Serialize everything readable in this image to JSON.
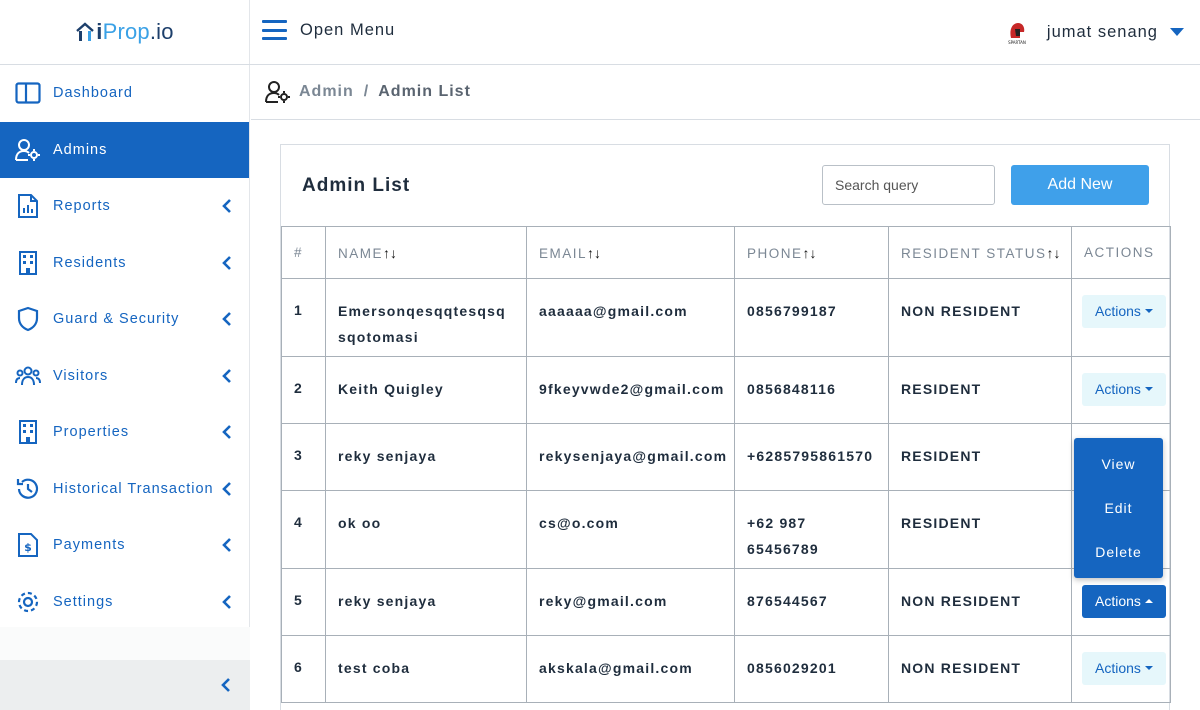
{
  "brand": {
    "name_part1": "i",
    "name_part2": "Prop",
    "name_part3": ".io"
  },
  "header": {
    "menu_label": "Open Menu",
    "user_name": "jumat senang",
    "avatar_caption": "SPARTAN"
  },
  "sidebar": {
    "items": [
      {
        "label": "Dashboard",
        "icon": "dashboard-icon",
        "has_submenu": false
      },
      {
        "label": "Admins",
        "icon": "admin-user-gear-icon",
        "has_submenu": false,
        "active": true
      },
      {
        "label": "Reports",
        "icon": "report-icon",
        "has_submenu": true
      },
      {
        "label": "Residents",
        "icon": "building-icon",
        "has_submenu": true
      },
      {
        "label": "Guard & Security",
        "icon": "shield-icon",
        "has_submenu": true
      },
      {
        "label": "Visitors",
        "icon": "visitors-icon",
        "has_submenu": true
      },
      {
        "label": "Properties",
        "icon": "building-icon",
        "has_submenu": true
      },
      {
        "label": "Historical Transaction",
        "icon": "history-icon",
        "has_submenu": true
      },
      {
        "label": "Payments",
        "icon": "payment-document-icon",
        "has_submenu": true
      },
      {
        "label": "Settings",
        "icon": "gear-icon",
        "has_submenu": true
      }
    ]
  },
  "breadcrumb": {
    "parent": "Admin",
    "separator": "/",
    "current": "Admin List"
  },
  "card": {
    "title": "Admin List",
    "search_placeholder": "Search query",
    "add_button": "Add New"
  },
  "table": {
    "headers": {
      "index": "#",
      "name": "NAME",
      "email": "EMAIL",
      "phone": "PHONE",
      "status": "RESIDENT STATUS",
      "actions": "ACTIONS"
    },
    "sort_glyph": "↑↓",
    "action_label": "Actions",
    "rows": [
      {
        "no": "1",
        "name": "Emersonqesqqtesqsqsqotomasi",
        "email": "aaaaaa@gmail.com",
        "phone": "0856799187",
        "status": "NON RESIDENT"
      },
      {
        "no": "2",
        "name": "Keith Quigley",
        "email": "9fkeyvwde2@gmail.com",
        "phone": "0856848116",
        "status": "RESIDENT"
      },
      {
        "no": "3",
        "name": "reky senjaya",
        "email": "rekysenjaya@gmail.com",
        "phone": "+6285795861570",
        "status": "RESIDENT"
      },
      {
        "no": "4",
        "name": "ok oo",
        "email": "cs@o.com",
        "phone": "+62 987 65456789",
        "status": "RESIDENT"
      },
      {
        "no": "5",
        "name": "reky senjaya",
        "email": "reky@gmail.com",
        "phone": "876544567",
        "status": "NON RESIDENT"
      },
      {
        "no": "6",
        "name": "test coba",
        "email": "akskala@gmail.com",
        "phone": "0856029201",
        "status": "NON RESIDENT"
      }
    ]
  },
  "dropdown": {
    "items": [
      "View",
      "Edit",
      "Delete"
    ]
  },
  "colors": {
    "primary": "#1565c0",
    "accent": "#3fa0ea",
    "muted": "#7b8794"
  }
}
